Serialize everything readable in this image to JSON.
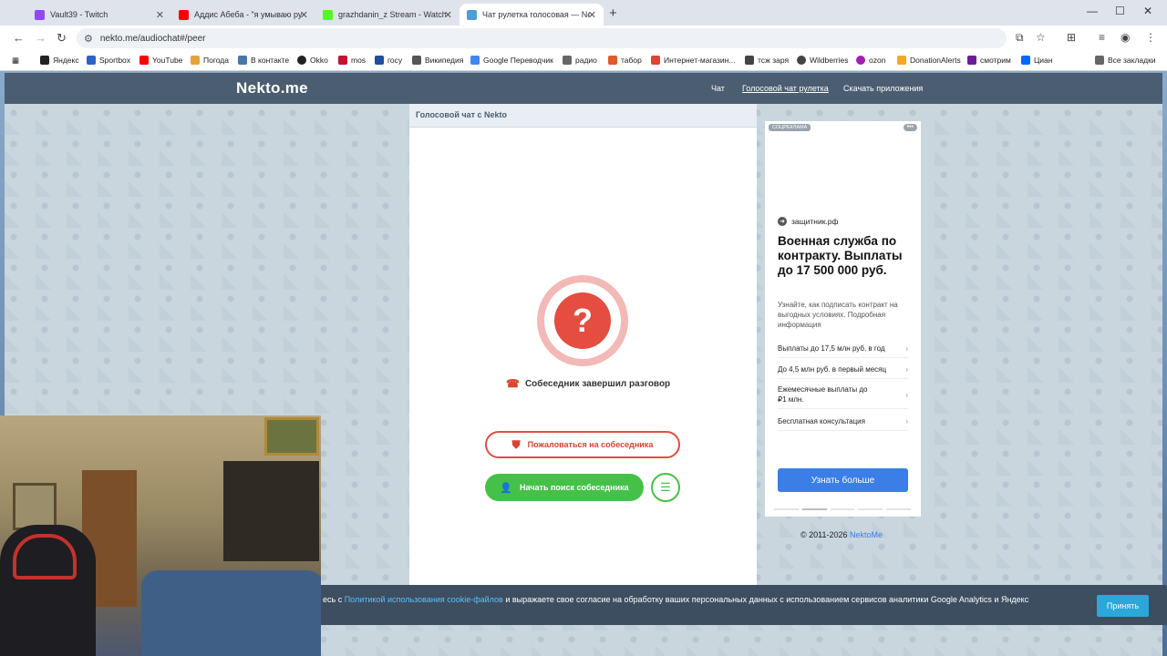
{
  "browser": {
    "tabs": [
      {
        "title": "Vault39 - Twitch",
        "color": "#9146ff"
      },
      {
        "title": "Аддис Абеба - \"я умываю рук",
        "color": "#ff0000"
      },
      {
        "title": "grazhdanin_z Stream - Watch L",
        "color": "#53fc18"
      },
      {
        "title": "Чат рулетка голосовая — Nekt",
        "color": "#4b9fd5"
      }
    ],
    "url": "nekto.me/audiochat#/peer",
    "bookmarks": [
      {
        "label": "Яндекс",
        "color": "#222"
      },
      {
        "label": "Sportbox",
        "color": "#2b63c7"
      },
      {
        "label": "YouTube",
        "color": "#ff0000"
      },
      {
        "label": "Погода",
        "color": "#e6a23c"
      },
      {
        "label": "В контакте",
        "color": "#4a76a8"
      },
      {
        "label": "Okko",
        "color": "#222"
      },
      {
        "label": "mos",
        "color": "#c41230"
      },
      {
        "label": "госу",
        "color": "#1d4ea0"
      },
      {
        "label": "Википедия",
        "color": "#555"
      },
      {
        "label": "Google Переводчик",
        "color": "#4285f4"
      },
      {
        "label": "радио",
        "color": "#666"
      },
      {
        "label": "табор",
        "color": "#e05a2b"
      },
      {
        "label": "Интернет-магазин...",
        "color": "#d43"
      },
      {
        "label": "тсж заря",
        "color": "#444"
      },
      {
        "label": "Wildberries",
        "color": "#444"
      },
      {
        "label": "ozon",
        "color": "#a11fae"
      },
      {
        "label": "DonationAlerts",
        "color": "#f5a623"
      },
      {
        "label": "смотрим",
        "color": "#6a1b9a"
      },
      {
        "label": "Циан",
        "color": "#0468ff"
      }
    ],
    "all_bookmarks": "Все закладки"
  },
  "site": {
    "logo": "Nekto.me",
    "nav": [
      "Чат",
      "Голосовой чат рулетка",
      "Скачать приложения"
    ]
  },
  "chat": {
    "header": "Голосовой чат с Nekto",
    "question_mark": "?",
    "status": "Собеседник завершил разговор",
    "report_label": "Пожаловаться на собеседника",
    "search_label": "Начать поиск собеседника"
  },
  "ad": {
    "tag": "СОЦРЕКЛАМА",
    "dots": "•••",
    "domain": "защитник.рф",
    "title": "Военная служба по контракту. Выплаты до 17 500 000 руб.",
    "description": "Узнайте, как подписать контракт на выгодных условиях. Подробная информация",
    "items": [
      "Выплаты до 17,5 млн руб. в год",
      "До 4,5 млн руб. в первый месяц",
      "Ежемесячные выплаты до ₽1 млн.",
      "Бесплатная консультация"
    ],
    "cta": "Узнать больше"
  },
  "footer": {
    "copyright": "© 2011-2026",
    "brand_link": "NektoMe"
  },
  "cookie": {
    "prefix": "есь с ",
    "link": "Политикой использования cookie-файлов",
    "suffix": " и выражаете свое согласие на обработку ваших персональных данных с использованием сервисов аналитики Google Analytics и Яндекс",
    "accept": "Принять"
  }
}
